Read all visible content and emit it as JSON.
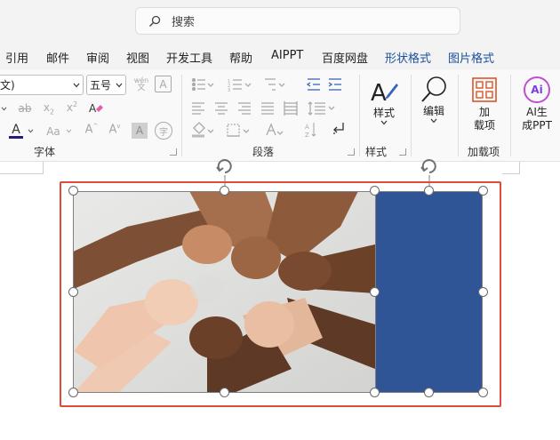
{
  "search": {
    "placeholder": "搜索"
  },
  "tabs": [
    {
      "label": "引用"
    },
    {
      "label": "邮件"
    },
    {
      "label": "审阅"
    },
    {
      "label": "视图"
    },
    {
      "label": "开发工具"
    },
    {
      "label": "帮助"
    },
    {
      "label": "AIPPT"
    },
    {
      "label": "百度网盘"
    },
    {
      "label": "形状格式"
    },
    {
      "label": "图片格式"
    }
  ],
  "font_group": {
    "font_name_value": "文)",
    "font_size_value": "五号",
    "phonetic_top": "wén",
    "phonetic_bottom": "文",
    "label": "字体"
  },
  "paragraph_group": {
    "label": "段落"
  },
  "styles_group": {
    "button_label": "样式",
    "label": "样式"
  },
  "editing": {
    "button_label": "编辑"
  },
  "addins_group": {
    "button_line1": "加",
    "button_line2": "载项",
    "label": "加载项"
  },
  "aippt": {
    "line1": "AI生",
    "line2": "成PPT",
    "icon_text": "Ai"
  },
  "colors": {
    "accent_blue": "#2f5597",
    "selection_red": "#e04a3a",
    "font_color_bar": "#1f1f7a",
    "tab_blue": "#1a4f9c",
    "addins_orange": "#d9552b"
  }
}
